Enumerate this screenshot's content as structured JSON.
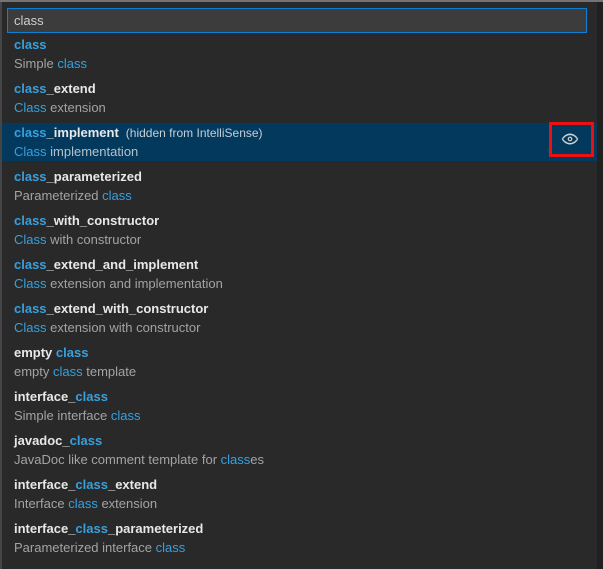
{
  "colors": {
    "match_highlight": "#37a0dd",
    "selection_background": "#04395e",
    "input_focus_border": "#0d7fd4",
    "annotation_red": "#ee1010"
  },
  "search": {
    "value": "class"
  },
  "list": {
    "selected_index": 2,
    "items": [
      {
        "label": [
          {
            "text": "class",
            "match": true
          }
        ],
        "description": [
          {
            "text": "Simple ",
            "match": false
          },
          {
            "text": "class",
            "match": true
          }
        ]
      },
      {
        "label": [
          {
            "text": "class",
            "match": true
          },
          {
            "text": "_extend",
            "match": false
          }
        ],
        "description": [
          {
            "text": "Class",
            "match": true
          },
          {
            "text": " extension",
            "match": false
          }
        ]
      },
      {
        "label": [
          {
            "text": "class",
            "match": true
          },
          {
            "text": "_implement",
            "match": false
          }
        ],
        "suffix": "(hidden from IntelliSense)",
        "description": [
          {
            "text": "Class",
            "match": true
          },
          {
            "text": " implementation",
            "match": false
          }
        ],
        "selected": true,
        "eye_icon": true
      },
      {
        "label": [
          {
            "text": "class",
            "match": true
          },
          {
            "text": "_parameterized",
            "match": false
          }
        ],
        "description": [
          {
            "text": "Parameterized ",
            "match": false
          },
          {
            "text": "class",
            "match": true
          }
        ]
      },
      {
        "label": [
          {
            "text": "class",
            "match": true
          },
          {
            "text": "_with_constructor",
            "match": false
          }
        ],
        "description": [
          {
            "text": "Class",
            "match": true
          },
          {
            "text": " with constructor",
            "match": false
          }
        ]
      },
      {
        "label": [
          {
            "text": "class",
            "match": true
          },
          {
            "text": "_extend_and_implement",
            "match": false
          }
        ],
        "description": [
          {
            "text": "Class",
            "match": true
          },
          {
            "text": " extension and implementation",
            "match": false
          }
        ]
      },
      {
        "label": [
          {
            "text": "class",
            "match": true
          },
          {
            "text": "_extend_with_constructor",
            "match": false
          }
        ],
        "description": [
          {
            "text": "Class",
            "match": true
          },
          {
            "text": " extension with constructor",
            "match": false
          }
        ]
      },
      {
        "label": [
          {
            "text": "empty ",
            "match": false
          },
          {
            "text": "class",
            "match": true
          }
        ],
        "description": [
          {
            "text": "empty ",
            "match": false
          },
          {
            "text": "class",
            "match": true
          },
          {
            "text": " template",
            "match": false
          }
        ]
      },
      {
        "label": [
          {
            "text": "interface_",
            "match": false
          },
          {
            "text": "class",
            "match": true
          }
        ],
        "description": [
          {
            "text": "Simple interface ",
            "match": false
          },
          {
            "text": "class",
            "match": true
          }
        ]
      },
      {
        "label": [
          {
            "text": "javadoc_",
            "match": false
          },
          {
            "text": "class",
            "match": true
          }
        ],
        "description": [
          {
            "text": "JavaDoc like comment template for ",
            "match": false
          },
          {
            "text": "class",
            "match": true
          },
          {
            "text": "es",
            "match": false
          }
        ]
      },
      {
        "label": [
          {
            "text": "interface_",
            "match": false
          },
          {
            "text": "class",
            "match": true
          },
          {
            "text": "_extend",
            "match": false
          }
        ],
        "description": [
          {
            "text": "Interface ",
            "match": false
          },
          {
            "text": "class",
            "match": true
          },
          {
            "text": " extension",
            "match": false
          }
        ]
      },
      {
        "label": [
          {
            "text": "interface_",
            "match": false
          },
          {
            "text": "class",
            "match": true
          },
          {
            "text": "_parameterized",
            "match": false
          }
        ],
        "description": [
          {
            "text": "Parameterized interface ",
            "match": false
          },
          {
            "text": "class",
            "match": true
          }
        ]
      }
    ]
  }
}
